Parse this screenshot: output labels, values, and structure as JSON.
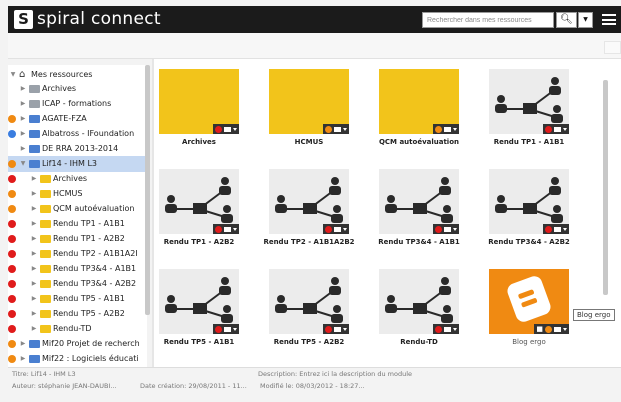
{
  "app": {
    "logo_mark": "S",
    "logo_text": "spiral connect"
  },
  "search": {
    "placeholder": "Rechercher dans mes ressources",
    "button_icon": "search-icon",
    "dropdown_icon": "caret-down-icon"
  },
  "tree": {
    "root": "Mes ressources",
    "items": [
      {
        "label": "Archives",
        "icon": "folder-icon"
      },
      {
        "label": "ICAP - formations",
        "icon": "folder-icon"
      },
      {
        "label": "AGATE-FZA",
        "icon": "module-icon",
        "status": "orange"
      },
      {
        "label": "Albatross - IFoundation",
        "icon": "module-icon",
        "status": "blue"
      },
      {
        "label": "DE RRA 2013-2014",
        "icon": "module-icon"
      },
      {
        "label": "Lif14 - IHM L3",
        "icon": "module-icon",
        "status": "orange",
        "selected": true
      },
      {
        "label": "Archives",
        "icon": "folder-icon",
        "status": "red"
      },
      {
        "label": "HCMUS",
        "icon": "folder-icon",
        "status": "orange"
      },
      {
        "label": "QCM autoévaluation",
        "icon": "folder-icon",
        "status": "orange"
      },
      {
        "label": "Rendu TP1 - A1B1",
        "icon": "folder-icon",
        "status": "red"
      },
      {
        "label": "Rendu TP1 - A2B2",
        "icon": "folder-icon",
        "status": "red"
      },
      {
        "label": "Rendu TP2 - A1B1A2I",
        "icon": "folder-icon",
        "status": "red"
      },
      {
        "label": "Rendu TP3&4 - A1B1",
        "icon": "folder-icon",
        "status": "red"
      },
      {
        "label": "Rendu TP3&4 - A2B2",
        "icon": "folder-icon",
        "status": "red"
      },
      {
        "label": "Rendu TP5 - A1B1",
        "icon": "folder-icon",
        "status": "red"
      },
      {
        "label": "Rendu TP5 - A2B2",
        "icon": "folder-icon",
        "status": "red"
      },
      {
        "label": "Rendu-TD",
        "icon": "folder-icon",
        "status": "red"
      },
      {
        "label": "Mif20 Projet de recherch",
        "icon": "module-icon",
        "status": "orange"
      },
      {
        "label": "Mif22 : Logiciels éducati",
        "icon": "module-icon",
        "status": "orange"
      }
    ]
  },
  "grid": {
    "tiles": [
      {
        "label": "Archives",
        "kind": "folder",
        "badge": "red"
      },
      {
        "label": "HCMUS",
        "kind": "folder",
        "badge": "orange"
      },
      {
        "label": "QCM autoévaluation",
        "kind": "folder",
        "badge": "orange"
      },
      {
        "label": "Rendu TP1 - A1B1",
        "kind": "network",
        "badge": "red"
      },
      {
        "label": "Rendu TP1 - A2B2",
        "kind": "network",
        "badge": "red"
      },
      {
        "label": "Rendu TP2 - A1B1A2B2",
        "kind": "network",
        "badge": "red"
      },
      {
        "label": "Rendu TP3&4 - A1B1",
        "kind": "network",
        "badge": "red"
      },
      {
        "label": "Rendu TP3&4 - A2B2",
        "kind": "network",
        "badge": "red"
      },
      {
        "label": "Rendu TP5 - A1B1",
        "kind": "network",
        "badge": "red"
      },
      {
        "label": "Rendu TP5 - A2B2",
        "kind": "network",
        "badge": "red"
      },
      {
        "label": "Rendu-TD",
        "kind": "network",
        "badge": "red"
      },
      {
        "label": "Blog ergo",
        "kind": "blog",
        "badge": "lock"
      }
    ]
  },
  "tooltip": "Blog ergo",
  "footer": {
    "title": "Titre: Lif14 - IHM L3",
    "description": "Description: Entrez ici la description du module",
    "author": "Auteur: stéphanie JEAN-DAUBI...",
    "created": "Date création: 29/08/2011 - 11...",
    "modified": "Modifié le: 08/03/2012 - 18:27..."
  },
  "colors": {
    "header": "#1b1b1b",
    "folder": "#f2c41b",
    "accent": "#f08a12",
    "status_red": "#e01b1b",
    "selected": "#c5d8f2"
  }
}
